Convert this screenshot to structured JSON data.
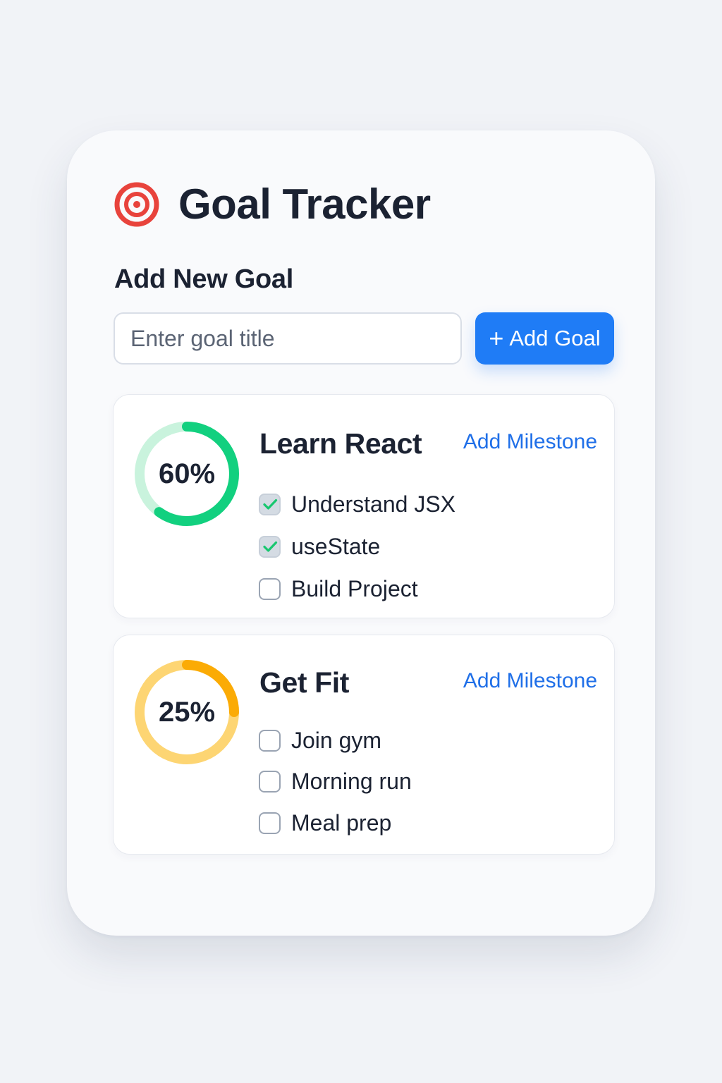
{
  "header": {
    "icon": "target-icon",
    "title": "Goal Tracker"
  },
  "add_goal": {
    "section_title": "Add New Goal",
    "input_placeholder": "Enter goal title",
    "input_value": "",
    "button_icon": "plus-icon",
    "button_label": "Add Goal"
  },
  "goals": [
    {
      "title": "Learn React",
      "progress_label": "60%",
      "progress": 0.6,
      "ring_color": "#12d07f",
      "ring_track_color": "#c9f3dd",
      "add_milestone_label": "Add Milestone",
      "milestones": [
        {
          "label": "Understand JSX",
          "done": true
        },
        {
          "label": "useState",
          "done": true
        },
        {
          "label": "Build Project",
          "done": false
        }
      ]
    },
    {
      "title": "Get Fit",
      "progress_label": "25%",
      "progress": 0.25,
      "ring_color": "#fbab05",
      "ring_track_color": "#fdd573",
      "add_milestone_label": "Add Milestone",
      "milestones": [
        {
          "label": "Join gym",
          "done": false
        },
        {
          "label": "Morning run",
          "done": false
        },
        {
          "label": "Meal prep",
          "done": false
        }
      ]
    }
  ],
  "colors": {
    "accent": "#1f7cf6",
    "link": "#1f6fe8",
    "check": "#18c76f",
    "target_red": "#e8433c"
  }
}
